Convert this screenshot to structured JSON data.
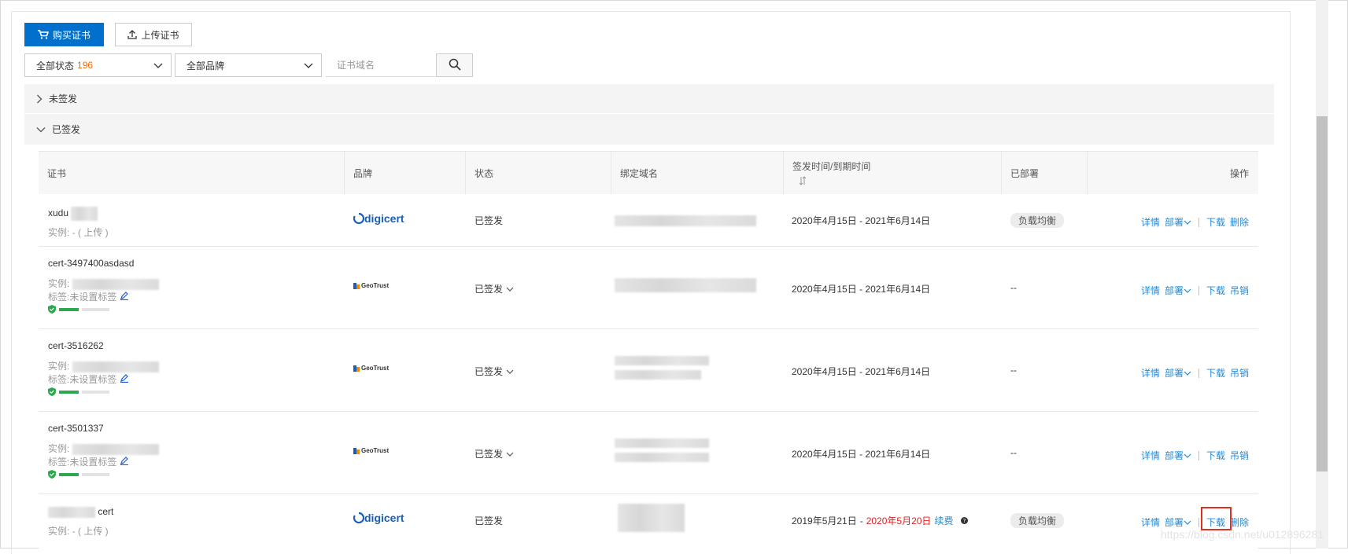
{
  "toolbar": {
    "buy_label": "购买证书",
    "upload_label": "上传证书"
  },
  "filters": {
    "status_label": "全部状态",
    "status_count": "196",
    "brand_label": "全部品牌",
    "search_placeholder": "证书域名"
  },
  "groups": {
    "unsigned": "未签发",
    "signed": "已签发"
  },
  "columns": {
    "cert": "证书",
    "brand": "品牌",
    "status": "状态",
    "domain": "绑定域名",
    "time": "签发时间/到期时间",
    "deployed": "已部署",
    "ops": "操作"
  },
  "rows": [
    {
      "name": "xudu",
      "instance": "实例: - ( 上传 )",
      "tag": "",
      "brand": "digicert",
      "brand_text": "digicert",
      "status": "已签发",
      "time_start": "2020年4月15日",
      "time_sep": "-",
      "time_end": "2021年6月14日",
      "deployed": "负载均衡",
      "op1": "详情",
      "op2": "部署",
      "op3": "下载",
      "op4": "删除"
    },
    {
      "name": "cert-3497400asdasd",
      "instance": "实例:",
      "tag": "标签:未设置标签",
      "brand": "geotrust",
      "brand_text": "GeoTrust",
      "status": "已签发",
      "time_start": "2020年4月15日",
      "time_sep": "-",
      "time_end": "2021年6月14日",
      "deployed": "--",
      "op1": "详情",
      "op2": "部署",
      "op3": "下载",
      "op4": "吊销"
    },
    {
      "name": "cert-3516262",
      "instance": "实例:",
      "tag": "标签:未设置标签",
      "brand": "geotrust",
      "brand_text": "GeoTrust",
      "status": "已签发",
      "time_start": "2020年4月15日",
      "time_sep": "-",
      "time_end": "2021年6月14日",
      "deployed": "--",
      "op1": "详情",
      "op2": "部署",
      "op3": "下载",
      "op4": "吊销"
    },
    {
      "name": "cert-3501337",
      "instance": "实例:",
      "tag": "标签:未设置标签",
      "brand": "geotrust",
      "brand_text": "GeoTrust",
      "status": "已签发",
      "time_start": "2020年4月15日",
      "time_sep": "-",
      "time_end": "2021年6月14日",
      "deployed": "--",
      "op1": "详情",
      "op2": "部署",
      "op3": "下载",
      "op4": "吊销"
    },
    {
      "name": "cert",
      "instance": "实例: - ( 上传 )",
      "tag": "",
      "brand": "digicert",
      "brand_text": "digicert",
      "status": "已签发",
      "time_start": "2019年5月21日",
      "time_sep": "-",
      "time_end": "2020年5月20日",
      "renew": "续费",
      "deployed": "负载均衡",
      "op1": "详情",
      "op2": "部署",
      "op3": "下载",
      "op4": "删除"
    }
  ],
  "watermark": "https://blog.csdn.net/u012896281",
  "colors": {
    "primary": "#0070cc",
    "link": "#1f8ad8",
    "warning_count": "#ff6600",
    "expired": "#e02020",
    "progress": "#2ca94f",
    "highlight": "#e0301e"
  }
}
